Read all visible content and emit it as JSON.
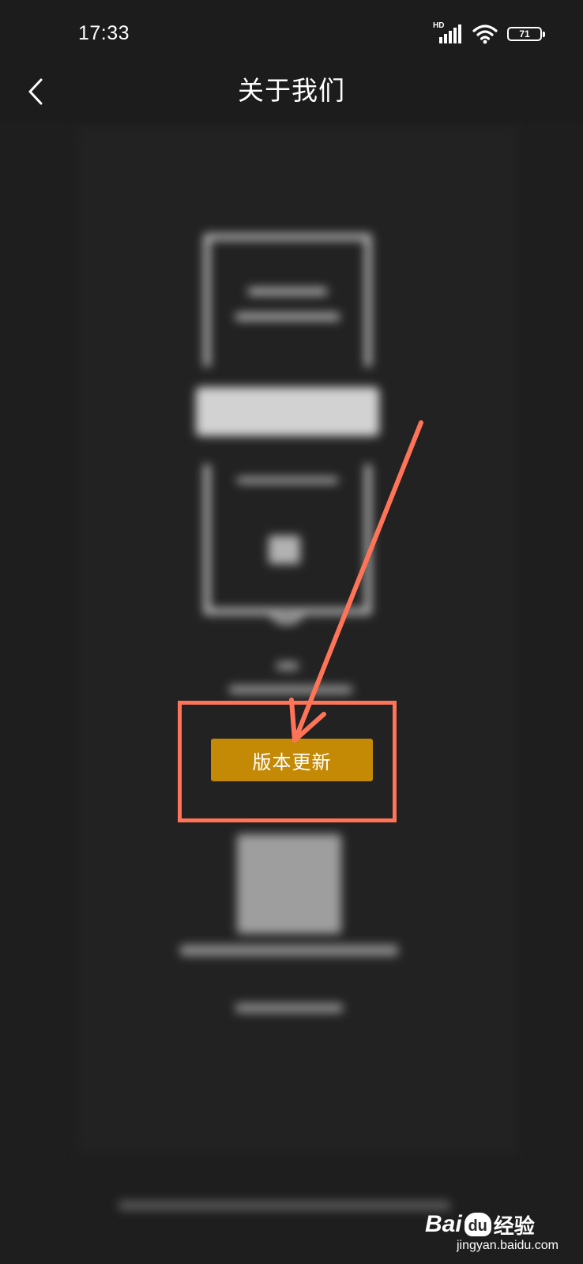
{
  "status_bar": {
    "time": "17:33",
    "network_label": "HD",
    "battery_level": "71",
    "icons": [
      "signal-icon",
      "wifi-icon",
      "battery-icon"
    ]
  },
  "nav": {
    "title": "关于我们",
    "back_icon": "chevron-left-icon"
  },
  "main": {
    "update_button_label": "版本更新"
  },
  "annotation": {
    "color": "#ff7458"
  },
  "watermark": {
    "brand_latin": "Bai",
    "brand_mark": "du",
    "brand_cn": "经验",
    "url": "jingyan.baidu.com"
  },
  "colors": {
    "background": "#1e1e1e",
    "accent": "#c48a06",
    "annotation": "#ff7458"
  }
}
